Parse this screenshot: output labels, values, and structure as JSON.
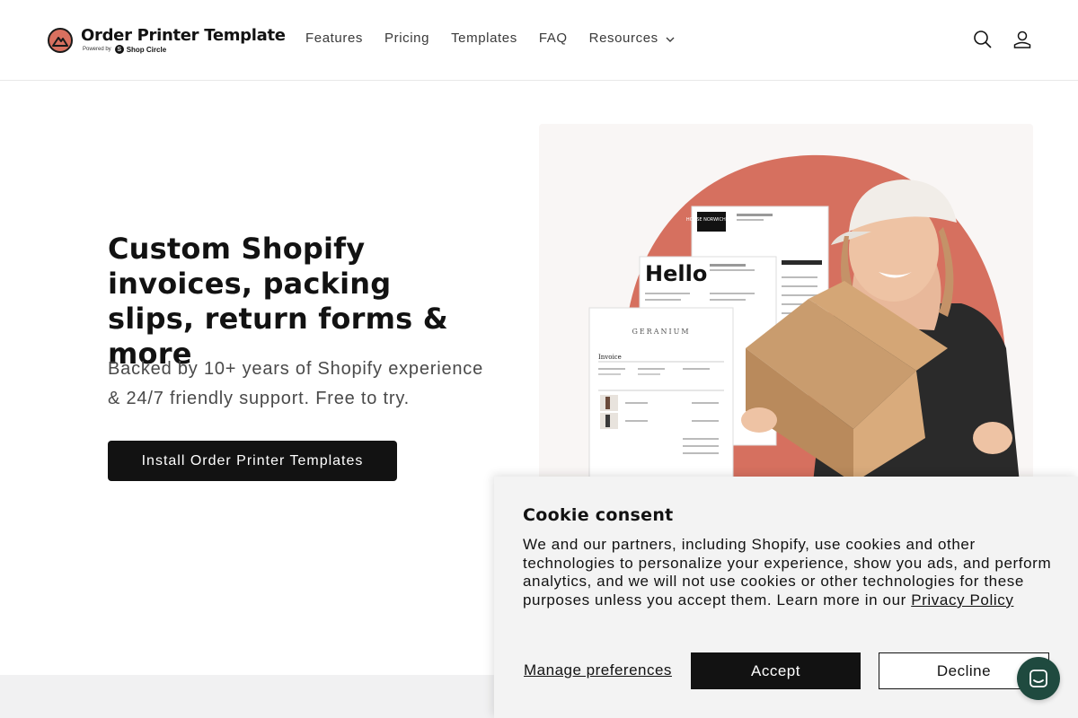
{
  "header": {
    "logo_title": "Order Printer Template",
    "logo_powered_by": "Powered by",
    "logo_brand": "Shop Circle",
    "nav": [
      {
        "label": "Features"
      },
      {
        "label": "Pricing"
      },
      {
        "label": "Templates"
      },
      {
        "label": "FAQ"
      },
      {
        "label": "Resources"
      }
    ],
    "icons": [
      "search-icon",
      "account-icon",
      "chevron-down-icon"
    ]
  },
  "hero": {
    "title": "Custom Shopify invoices, packing slips, return forms & more",
    "subtitle": "Backed by 10+ years of Shopify experience & 24/7 friendly support. Free to try.",
    "cta_label": "Install Order Printer Templates",
    "image_docs": {
      "doc1_brand": "HOUSE NORWICH HILL",
      "doc2_title": "Hello",
      "doc3_brand": "GERANIUM",
      "doc3_heading": "Invoice"
    }
  },
  "cookie": {
    "title": "Cookie consent",
    "body": "We and our partners, including Shopify, use cookies and other technologies to personalize your experience, show you ads, and perform analytics, and we will not use cookies or other technologies for these purposes unless you accept them. Learn more in our",
    "link_label": "Privacy Policy",
    "manage_label": "Manage preferences",
    "accept_label": "Accept",
    "decline_label": "Decline"
  },
  "colors": {
    "accent_blob": "#d6705f",
    "primary_button": "#121212",
    "chat_button": "#1f4a3f",
    "band": "#f1f1f2"
  }
}
